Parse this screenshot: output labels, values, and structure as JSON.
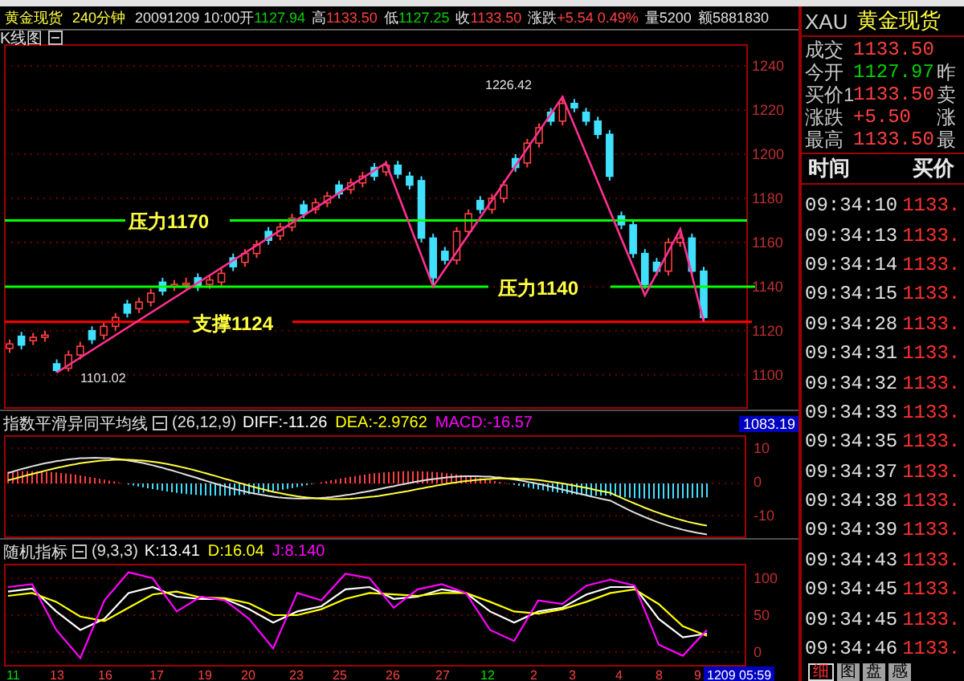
{
  "quote_bar": {
    "symbol": "黄金现货",
    "period": "240分钟",
    "datetime": "20091209 10:00",
    "fields": [
      {
        "label": "开",
        "value": "1127.94",
        "kind": "down"
      },
      {
        "label": "高",
        "value": "1133.50",
        "kind": "up"
      },
      {
        "label": "低",
        "value": "1127.25",
        "kind": "down"
      },
      {
        "label": "收",
        "value": "1133.50",
        "kind": "up"
      },
      {
        "label": "涨跌",
        "value": "+5.54 0.49%",
        "kind": "up"
      },
      {
        "label": "量",
        "value": "5200",
        "kind": "neutral"
      },
      {
        "label": "额",
        "value": "5881830",
        "kind": "neutral"
      }
    ]
  },
  "main_chart": {
    "title": "K线图",
    "chart_data": {
      "type": "candlestick",
      "ylim": [
        1085,
        1249.5
      ],
      "yticks": [
        1100,
        1120,
        1140,
        1160,
        1180,
        1200,
        1220,
        1240
      ],
      "grid": true,
      "ohlc": [
        [
          1112,
          1116,
          1110,
          1114
        ],
        [
          1117.5,
          1119.5,
          1111.5,
          1113.5
        ],
        [
          1115.5,
          1119,
          1113.5,
          1117
        ],
        [
          1117,
          1120,
          1115,
          1118
        ],
        [
          1105,
          1107,
          1101.02,
          1102
        ],
        [
          1103,
          1111,
          1101.5,
          1109
        ],
        [
          1109,
          1115,
          1107,
          1113
        ],
        [
          1120,
          1122,
          1114,
          1116
        ],
        [
          1118,
          1124,
          1116,
          1122
        ],
        [
          1122,
          1128,
          1120,
          1126
        ],
        [
          1132,
          1134,
          1126,
          1128
        ],
        [
          1130,
          1135,
          1128,
          1133
        ],
        [
          1133,
          1139,
          1131,
          1137
        ],
        [
          1142,
          1144,
          1136,
          1138
        ],
        [
          1140,
          1143,
          1138,
          1141
        ],
        [
          1141,
          1144,
          1139,
          1141.5
        ],
        [
          1144,
          1146,
          1138,
          1140
        ],
        [
          1141,
          1145,
          1139,
          1143
        ],
        [
          1142,
          1148,
          1140,
          1146
        ],
        [
          1153,
          1155,
          1147,
          1149
        ],
        [
          1151,
          1157,
          1149,
          1155
        ],
        [
          1155,
          1161,
          1153,
          1159
        ],
        [
          1165,
          1167,
          1159,
          1161
        ],
        [
          1163,
          1169,
          1161,
          1167
        ],
        [
          1167,
          1173,
          1165,
          1171
        ],
        [
          1177,
          1179,
          1171,
          1173
        ],
        [
          1175,
          1180,
          1173,
          1178
        ],
        [
          1178,
          1183,
          1176,
          1181
        ],
        [
          1186,
          1188,
          1180,
          1182
        ],
        [
          1184,
          1189,
          1182,
          1187
        ],
        [
          1187,
          1192,
          1185,
          1190
        ],
        [
          1194,
          1196,
          1188,
          1190
        ],
        [
          1192,
          1197,
          1190,
          1195
        ],
        [
          1195,
          1197,
          1189,
          1191
        ],
        [
          1190,
          1192,
          1184,
          1186
        ],
        [
          1188,
          1190,
          1160,
          1162
        ],
        [
          1162,
          1164,
          1140,
          1144
        ],
        [
          1156,
          1158,
          1150,
          1152
        ],
        [
          1152,
          1167,
          1150,
          1165
        ],
        [
          1165,
          1175,
          1163,
          1173
        ],
        [
          1179,
          1181,
          1173,
          1175
        ],
        [
          1175,
          1182,
          1173,
          1180
        ],
        [
          1180,
          1188,
          1178,
          1186
        ],
        [
          1198,
          1200,
          1192,
          1194
        ],
        [
          1196,
          1207,
          1194,
          1205
        ],
        [
          1205,
          1214,
          1203,
          1212
        ],
        [
          1219,
          1221,
          1213,
          1215
        ],
        [
          1215,
          1226.42,
          1213,
          1223
        ],
        [
          1223,
          1225,
          1219,
          1221
        ],
        [
          1219,
          1221,
          1213,
          1215
        ],
        [
          1215,
          1217,
          1207,
          1209
        ],
        [
          1209,
          1211,
          1188,
          1190
        ],
        [
          1172,
          1174,
          1166,
          1168
        ],
        [
          1168,
          1170,
          1153,
          1155
        ],
        [
          1155,
          1157,
          1139,
          1141
        ],
        [
          1151,
          1153,
          1145,
          1147
        ],
        [
          1147,
          1162,
          1145,
          1160
        ],
        [
          1160,
          1164,
          1158,
          1162
        ],
        [
          1162,
          1164,
          1145,
          1147
        ],
        [
          1147,
          1149,
          1124,
          1126
        ]
      ]
    },
    "levels": [
      {
        "kind": "resistance",
        "label": "压力1170"
      },
      {
        "kind": "resistance",
        "label": "压力1140"
      },
      {
        "kind": "support",
        "label": "支撑1124"
      }
    ],
    "high_label": "1226.42",
    "low_label": "1101.02"
  },
  "indicators": [
    {
      "kind": "macd",
      "title": "指数平滑异同平均线",
      "params": "(26,12,9)",
      "values": [
        {
          "text": "DIFF:-11.26",
          "color": "#ffffff"
        },
        {
          "text": "DEA:-2.9762",
          "color": "#ffff00"
        },
        {
          "text": "MACD:-16.57",
          "color": "#ff00ff"
        }
      ],
      "axis": [
        "10",
        "0",
        "-10"
      ],
      "badge": "1083.19"
    },
    {
      "kind": "kdj",
      "title": "随机指标",
      "params": "(9,3,3)",
      "values": [
        {
          "text": "K:13.41",
          "color": "#ffffff"
        },
        {
          "text": "D:16.04",
          "color": "#ffff00"
        },
        {
          "text": "J:8.140",
          "color": "#ff00ff"
        }
      ],
      "chart_data": {
        "type": "line",
        "ylim": [
          -18.5,
          118.5
        ],
        "yticks": [
          0,
          50,
          100
        ],
        "grid": true,
        "series": [
          {
            "color": "#ffffff",
            "values": [
              82,
              86,
              55,
              30,
              45,
              80,
              88,
              75,
              72,
              72,
              58,
              40,
              55,
              62,
              85,
              88,
              72,
              75,
              85,
              80,
              55,
              40,
              55,
              60,
              78,
              88,
              88,
              45,
              20,
              25
            ]
          },
          {
            "color": "#ffff00",
            "values": [
              76,
              80,
              68,
              48,
              42,
              60,
              78,
              82,
              74,
              73,
              66,
              50,
              50,
              58,
              72,
              80,
              78,
              76,
              80,
              80,
              68,
              55,
              52,
              58,
              68,
              80,
              85,
              65,
              35,
              22
            ]
          },
          {
            "color": "#ff00ff",
            "values": [
              88,
              92,
              30,
              -8,
              70,
              108,
              100,
              55,
              75,
              70,
              45,
              5,
              80,
              70,
              106,
              100,
              60,
              85,
              92,
              80,
              30,
              15,
              70,
              65,
              90,
              98,
              90,
              10,
              -5,
              30
            ]
          }
        ]
      }
    }
  ],
  "date_axis": {
    "labels": [
      {
        "text": "11",
        "month_start": true
      },
      {
        "text": "13",
        "month_start": false
      },
      {
        "text": "16",
        "month_start": false
      },
      {
        "text": "17",
        "month_start": false
      },
      {
        "text": "19",
        "month_start": false
      },
      {
        "text": "20",
        "month_start": false
      },
      {
        "text": "23",
        "month_start": false
      },
      {
        "text": "25",
        "month_start": false
      },
      {
        "text": "26",
        "month_start": false
      },
      {
        "text": "27",
        "month_start": false
      },
      {
        "text": "12",
        "month_start": true
      },
      {
        "text": "2",
        "month_start": false
      },
      {
        "text": "3",
        "month_start": false
      },
      {
        "text": "4",
        "month_start": false
      },
      {
        "text": "8",
        "month_start": false
      },
      {
        "text": "9",
        "month_start": false
      }
    ],
    "badge": "1209 05:59"
  },
  "side_panel": {
    "symbol": "XAU",
    "name": "黄金现货",
    "quote_rows": [
      {
        "label": "成交",
        "value": "1133.50",
        "kind": "up"
      },
      {
        "label": "今开",
        "value": "1127.97",
        "kind": "down",
        "extra": "昨"
      },
      {
        "label": "买价1",
        "value": "1133.50",
        "kind": "up",
        "extra": "卖"
      },
      {
        "label": "涨跌",
        "value": "+5.50",
        "kind": "up",
        "extra": "涨"
      },
      {
        "label": "最高",
        "value": "1133.50",
        "kind": "up",
        "extra": "最"
      }
    ],
    "ticks_header": [
      "时间",
      "买价"
    ],
    "ticks": [
      {
        "time": "09:34:10",
        "price": "1133."
      },
      {
        "time": "09:34:13",
        "price": "1133."
      },
      {
        "time": "09:34:14",
        "price": "1133."
      },
      {
        "time": "09:34:15",
        "price": "1133."
      },
      {
        "time": "09:34:28",
        "price": "1133."
      },
      {
        "time": "09:34:31",
        "price": "1133."
      },
      {
        "time": "09:34:32",
        "price": "1133."
      },
      {
        "time": "09:34:33",
        "price": "1133."
      },
      {
        "time": "09:34:35",
        "price": "1133."
      },
      {
        "time": "09:34:37",
        "price": "1133."
      },
      {
        "time": "09:34:38",
        "price": "1133."
      },
      {
        "time": "09:34:39",
        "price": "1133."
      },
      {
        "time": "09:34:43",
        "price": "1133."
      },
      {
        "time": "09:34:45",
        "price": "1133."
      },
      {
        "time": "09:34:45",
        "price": "1133."
      },
      {
        "time": "09:34:46",
        "price": "1133."
      }
    ],
    "tabs": [
      {
        "label": "细",
        "selected": true
      },
      {
        "label": "图",
        "selected": false
      },
      {
        "label": "盘",
        "selected": false
      },
      {
        "label": "感",
        "selected": false
      }
    ]
  }
}
